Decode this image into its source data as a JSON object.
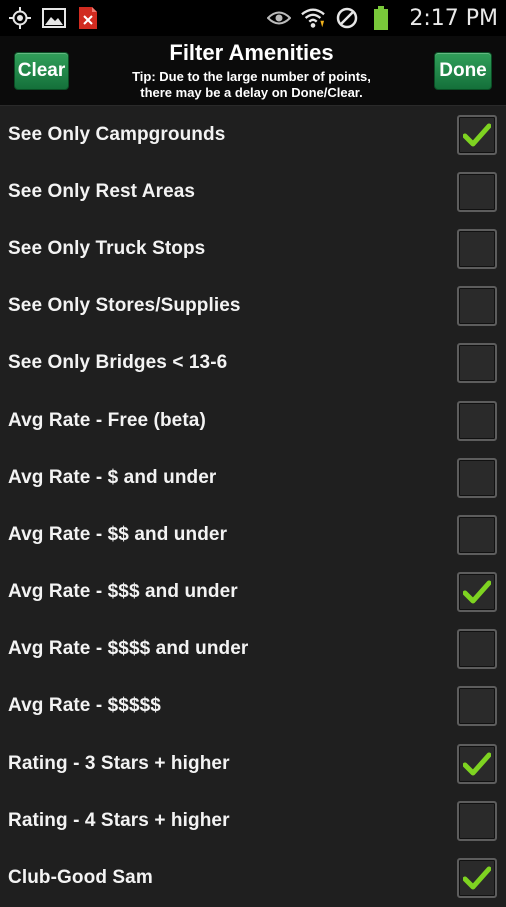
{
  "status_bar": {
    "time": "2:17 PM",
    "icons_left": [
      "gps-icon",
      "image-icon",
      "pdf-icon"
    ],
    "icons_right": [
      "eye-icon",
      "wifi-icon",
      "no-signal-icon",
      "battery-icon"
    ]
  },
  "header": {
    "title": "Filter Amenities",
    "tip_line1": "Tip: Due to the large number of points,",
    "tip_line2": "there may be a delay on Done/Clear.",
    "clear_label": "Clear",
    "done_label": "Done"
  },
  "filters": [
    {
      "label": "See Only Campgrounds",
      "checked": true
    },
    {
      "label": "See Only Rest Areas",
      "checked": false
    },
    {
      "label": "See Only Truck Stops",
      "checked": false
    },
    {
      "label": "See Only Stores/Supplies",
      "checked": false
    },
    {
      "label": "See Only Bridges < 13-6",
      "checked": false
    },
    {
      "label": "Avg Rate - Free (beta)",
      "checked": false
    },
    {
      "label": "Avg Rate - $ and under",
      "checked": false
    },
    {
      "label": "Avg Rate - $$ and under",
      "checked": false
    },
    {
      "label": "Avg Rate - $$$ and under",
      "checked": true
    },
    {
      "label": "Avg Rate - $$$$ and under",
      "checked": false
    },
    {
      "label": "Avg Rate - $$$$$",
      "checked": false
    },
    {
      "label": "Rating - 3 Stars + higher",
      "checked": true
    },
    {
      "label": "Rating - 4 Stars + higher",
      "checked": false
    },
    {
      "label": "Club-Good Sam",
      "checked": true
    }
  ],
  "colors": {
    "accent_green": "#1f8a45",
    "check_green": "#7ed321",
    "background": "#1f1f1f"
  }
}
